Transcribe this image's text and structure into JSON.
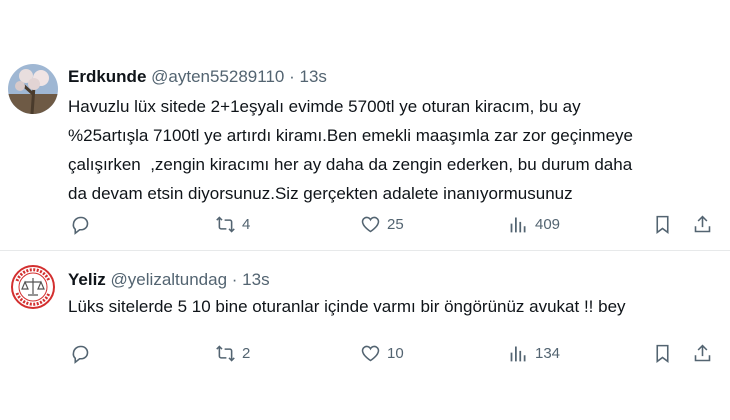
{
  "tweets": [
    {
      "name": "Erdkunde",
      "handle": "@ayten55289110",
      "time": "13s",
      "avatar": "avatar-photo-tree",
      "lines": [
        "Havuzlu lüx sitede 2+1eşyalı evimde 5700tl ye oturan kiracım, bu ay",
        "%25artışla 7100tl ye artırdı kiramı.Ben emekli maaşımla zar zor geçinmeye",
        "çalışırken  ,zengin kiracımı her ay daha da zengin ederken, bu durum daha",
        "da devam etsin diyorsunuz.Siz gerçekten adalete inanıyormusunuz"
      ],
      "replies": "",
      "retweets": "4",
      "likes": "25",
      "views": "409"
    },
    {
      "name": "Yeliz",
      "handle": "@yelizaltundag",
      "time": "13s",
      "avatar": "avatar-seal-logo",
      "lines": [
        "Lüks sitelerde 5 10 bine oturanlar içinde varmı bir öngörünüz avukat !! bey"
      ],
      "replies": "",
      "retweets": "2",
      "likes": "10",
      "views": "134"
    }
  ],
  "separator": " · ",
  "colors": {
    "text": "#0f1419",
    "secondary": "#536471",
    "divider": "#e7e9ea",
    "seal_red": "#d32f2f"
  },
  "icons": [
    "reply-icon",
    "retweet-icon",
    "like-icon",
    "views-icon",
    "bookmark-icon",
    "share-icon"
  ]
}
